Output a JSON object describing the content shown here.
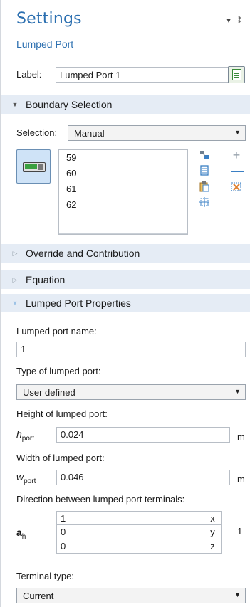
{
  "header": {
    "title": "Settings",
    "subtitle": "Lumped Port",
    "collapse_glyph": "▼",
    "pin_glyph": "⁑"
  },
  "label_row": {
    "label": "Label:",
    "value": "Lumped Port 1"
  },
  "sections": {
    "boundary_selection": "Boundary Selection",
    "override": "Override and Contribution",
    "equation": "Equation",
    "properties": "Lumped Port Properties"
  },
  "selection": {
    "label": "Selection:",
    "value": "Manual",
    "items": [
      "59",
      "60",
      "61",
      "62"
    ]
  },
  "properties": {
    "port_name_label": "Lumped port name:",
    "port_name_value": "1",
    "type_label": "Type of lumped port:",
    "type_value": "User defined",
    "height_label": "Height of lumped port:",
    "height_symbol": "h",
    "height_sub": "port",
    "height_value": "0.024",
    "height_unit": "m",
    "width_label": "Width of lumped port:",
    "width_symbol": "w",
    "width_sub": "port",
    "width_value": "0.046",
    "width_unit": "m",
    "direction_label": "Direction between lumped port terminals:",
    "direction_symbol": "a",
    "direction_sub": "h",
    "direction_values": [
      "1",
      "0",
      "0"
    ],
    "direction_components": [
      "x",
      "y",
      "z"
    ],
    "direction_unit": "1",
    "terminal_label": "Terminal type:",
    "terminal_value": "Current"
  },
  "colors": {
    "accent": "#2b6fb0",
    "section_bg": "#e5ecf5",
    "toggle_bg": "#cfe3f7"
  }
}
